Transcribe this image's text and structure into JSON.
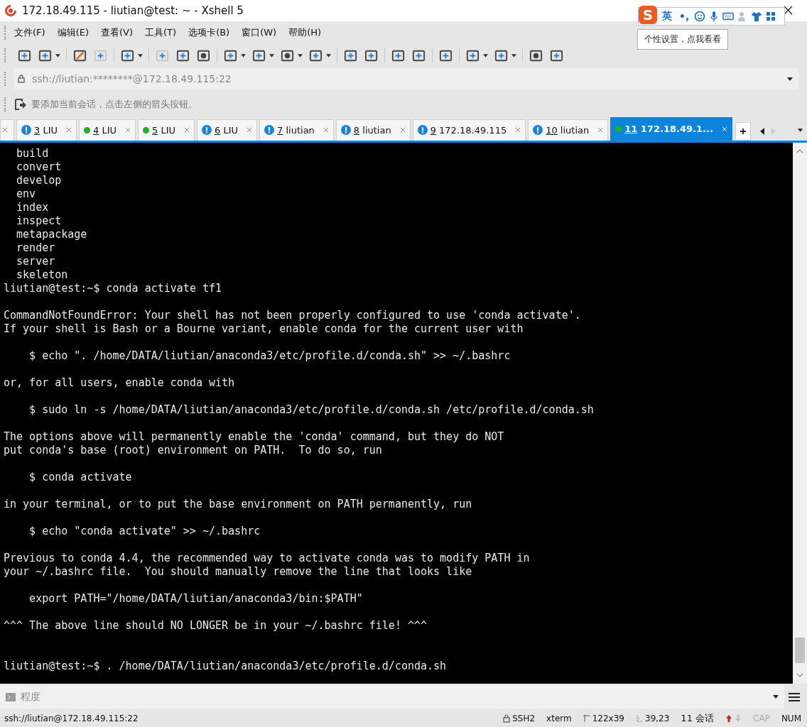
{
  "window": {
    "title": "172.18.49.115 - liutian@test: ~ - Xshell 5"
  },
  "menu": [
    "文件(F)",
    "编辑(E)",
    "查看(V)",
    "工具(T)",
    "选项卡(B)",
    "窗口(W)",
    "帮助(H)"
  ],
  "address": {
    "value": "ssh://liutian:********@172.18.49.115:22"
  },
  "hint": "要添加当前会话，点击左侧的箭头按钮。",
  "tabs": [
    {
      "number": "3",
      "label": "LIU",
      "kind": "alert",
      "selected": false
    },
    {
      "number": "4",
      "label": "LIU",
      "kind": "connected",
      "selected": false
    },
    {
      "number": "5",
      "label": "LIU",
      "kind": "connected",
      "selected": false
    },
    {
      "number": "6",
      "label": "LIU",
      "kind": "alert",
      "selected": false
    },
    {
      "number": "7",
      "label": "liutian",
      "kind": "alert",
      "selected": false
    },
    {
      "number": "8",
      "label": "liutian",
      "kind": "alert",
      "selected": false
    },
    {
      "number": "9",
      "label": "172.18.49.115",
      "kind": "alert",
      "selected": false
    },
    {
      "number": "10",
      "label": "liutian",
      "kind": "alert",
      "selected": false
    },
    {
      "number": "11",
      "label": "172.18.49.1...",
      "kind": "connected",
      "selected": true
    }
  ],
  "terminal": {
    "blocks": [
      {
        "lines": [
          "  build",
          "  convert",
          "  develop",
          "  env",
          "  index",
          "  inspect",
          "  metapackage",
          "  render",
          "  server",
          "  skeleton",
          "liutian@test:~$ conda activate tf1"
        ]
      },
      {
        "lines": [
          "CommandNotFoundError: Your shell has not been properly configured to use 'conda activate'.",
          "If your shell is Bash or a Bourne variant, enable conda for the current user with"
        ]
      },
      {
        "lines": [
          "    $ echo \". /home/DATA/liutian/anaconda3/etc/profile.d/conda.sh\" >> ~/.bashrc"
        ]
      },
      {
        "lines": [
          "or, for all users, enable conda with"
        ]
      },
      {
        "lines": [
          "    $ sudo ln -s /home/DATA/liutian/anaconda3/etc/profile.d/conda.sh /etc/profile.d/conda.sh"
        ]
      },
      {
        "lines": [
          "The options above will permanently enable the 'conda' command, but they do NOT",
          "put conda's base (root) environment on PATH.  To do so, run"
        ]
      },
      {
        "lines": [
          "    $ conda activate"
        ]
      },
      {
        "lines": [
          "in your terminal, or to put the base environment on PATH permanently, run"
        ]
      },
      {
        "lines": [
          "    $ echo \"conda activate\" >> ~/.bashrc"
        ]
      },
      {
        "lines": [
          "Previous to conda 4.4, the recommended way to activate conda was to modify PATH in",
          "your ~/.bashrc file.  You should manually remove the line that looks like"
        ]
      },
      {
        "lines": [
          "    export PATH=\"/home/DATA/liutian/anaconda3/bin:$PATH\""
        ]
      },
      {
        "lines": [
          "^^^ The above line should NO LONGER be in your ~/.bashrc file! ^^^"
        ]
      }
    ],
    "current_line": "liutian@test:~$ . /home/DATA/liutian/anaconda3/etc/profile.d/conda.sh"
  },
  "compose_bar": {
    "label": "程度"
  },
  "status_bar": {
    "connection": "ssh://liutian@172.18.49.115:22",
    "protocol": "SSH2",
    "terminal_type": "xterm",
    "size": "122x39",
    "cursor": "39,23",
    "sessions": "11 会话",
    "indicators": [
      {
        "label": "CAP",
        "on": false
      },
      {
        "label": "NUM",
        "on": true
      }
    ]
  },
  "ime": {
    "logo": "S",
    "mode": "英",
    "punctuation": "•,",
    "tooltip": "个性设置，点我看看"
  }
}
